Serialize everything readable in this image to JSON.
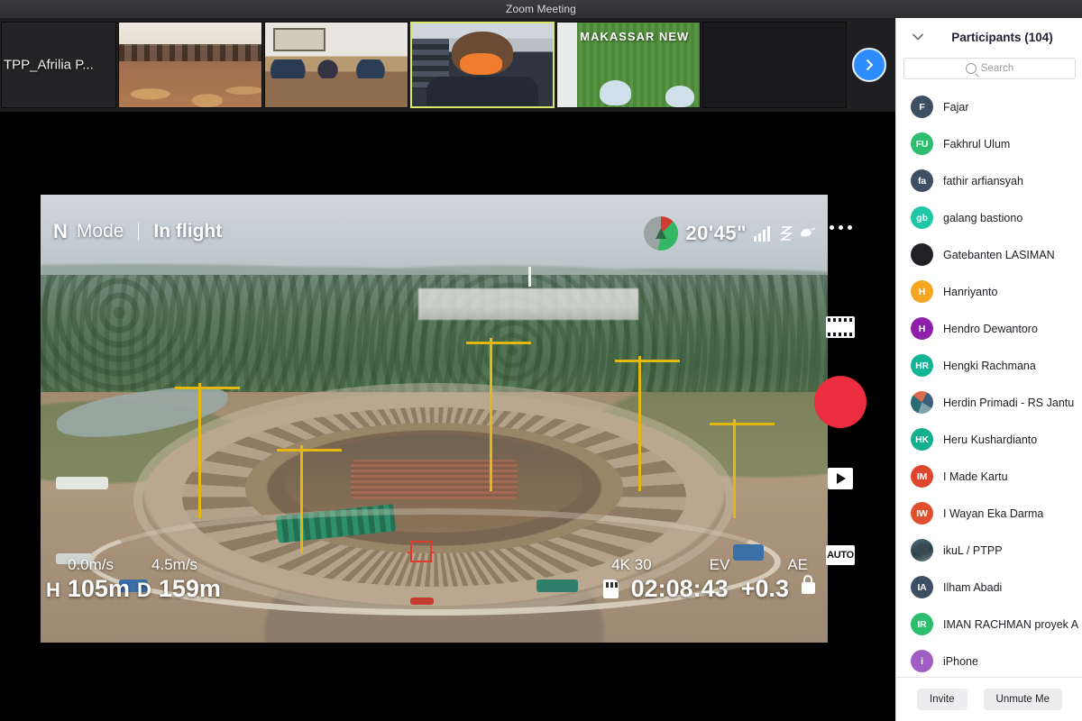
{
  "window": {
    "title": "Zoom Meeting"
  },
  "filmstrip": {
    "next_button_icon": "chevron-right-icon",
    "thumbnails": [
      {
        "label": "TPP_Afrilia P...",
        "type": "name-only",
        "active": false
      },
      {
        "label": "",
        "type": "ballroom",
        "active": false
      },
      {
        "label": "",
        "type": "meetingroom",
        "active": false
      },
      {
        "label": "",
        "type": "person",
        "active": true
      },
      {
        "label": "MAKASSAR  NEW",
        "type": "field",
        "active": false
      },
      {
        "label": "",
        "type": "empty",
        "active": false
      }
    ]
  },
  "drone_hud": {
    "flight_mode_letter": "N",
    "flight_mode_label": "Mode",
    "flight_status": "In flight",
    "flight_time": "20'45\"",
    "signal_icon": "signal-bars-icon",
    "satellite_icon": "satellite-icon",
    "wind_icon": "wind-icon",
    "battery_icon": "battery-dial-icon",
    "more_icon": "more-dots-icon",
    "horizontal_speed": "0.0m/s",
    "vertical_speed": "4.5m/s",
    "height_label": "H",
    "height_value": "105m",
    "distance_label": "D",
    "distance_value": "159m",
    "video_format": "4K 30",
    "ev_label": "EV",
    "ev_value": "+0.3",
    "ae_label": "AE",
    "sd_icon": "sd-card-icon",
    "record_time": "02:08:43",
    "lock_icon": "lock-icon",
    "focus_icon": "focus-bracket-icon"
  },
  "camera_controls": {
    "more_icon": "more-dots-icon",
    "mode_icon": "film-strip-icon",
    "shutter_icon": "record-shutter-icon",
    "playback_icon": "playback-play-icon",
    "auto_label": "AUTO"
  },
  "panel": {
    "collapse_icon": "chevron-down-icon",
    "title": "Participants (104)",
    "search": {
      "icon": "search-icon",
      "placeholder": "Search",
      "value": ""
    },
    "participants": [
      {
        "name": "Fajar",
        "initials": "F",
        "color": "#3f4f63",
        "avatar": "initials"
      },
      {
        "name": "Fakhrul Ulum",
        "initials": "FU",
        "color": "#2dbd6e",
        "avatar": "initials"
      },
      {
        "name": "fathir arfiansyah",
        "initials": "fa",
        "color": "#3f4f63",
        "avatar": "initials"
      },
      {
        "name": "galang bastiono",
        "initials": "gb",
        "color": "#1ec8a5",
        "avatar": "initials"
      },
      {
        "name": "Gatebanten LASIMAN",
        "initials": "",
        "color": "#1f2124",
        "avatar": "initials"
      },
      {
        "name": "Hanriyanto",
        "initials": "H",
        "color": "#f5a623",
        "avatar": "initials"
      },
      {
        "name": "Hendro Dewantoro",
        "initials": "H",
        "color": "#8e1fa8",
        "avatar": "initials"
      },
      {
        "name": "Hengki Rachmana",
        "initials": "HR",
        "color": "#13b396",
        "avatar": "initials"
      },
      {
        "name": "Herdin Primadi - RS Jantu",
        "initials": "",
        "color": "#2b6b74",
        "avatar": "photo2"
      },
      {
        "name": "Heru Kushardianto",
        "initials": "HK",
        "color": "#13b08f",
        "avatar": "initials"
      },
      {
        "name": "I Made Kartu",
        "initials": "IM",
        "color": "#e0452e",
        "avatar": "initials"
      },
      {
        "name": "I Wayan Eka Darma",
        "initials": "IW",
        "color": "#e0502e",
        "avatar": "initials"
      },
      {
        "name": "ikuL / PTPP",
        "initials": "",
        "color": "#4e6d7a",
        "avatar": "photo"
      },
      {
        "name": "Ilham Abadi",
        "initials": "IA",
        "color": "#3f4f63",
        "avatar": "initials"
      },
      {
        "name": "IMAN RACHMAN proyek A",
        "initials": "IR",
        "color": "#2dbd6e",
        "avatar": "initials"
      },
      {
        "name": "iPhone",
        "initials": "i",
        "color": "#a05ec4",
        "avatar": "initials"
      }
    ],
    "footer": {
      "invite_label": "Invite",
      "unmute_label": "Unmute Me"
    }
  },
  "colors": {
    "accent_blue": "#2d8cff",
    "record_red": "#eb2d3f",
    "panel_bg": "#ffffff",
    "titlebar_bg": "#3c3c3e"
  }
}
